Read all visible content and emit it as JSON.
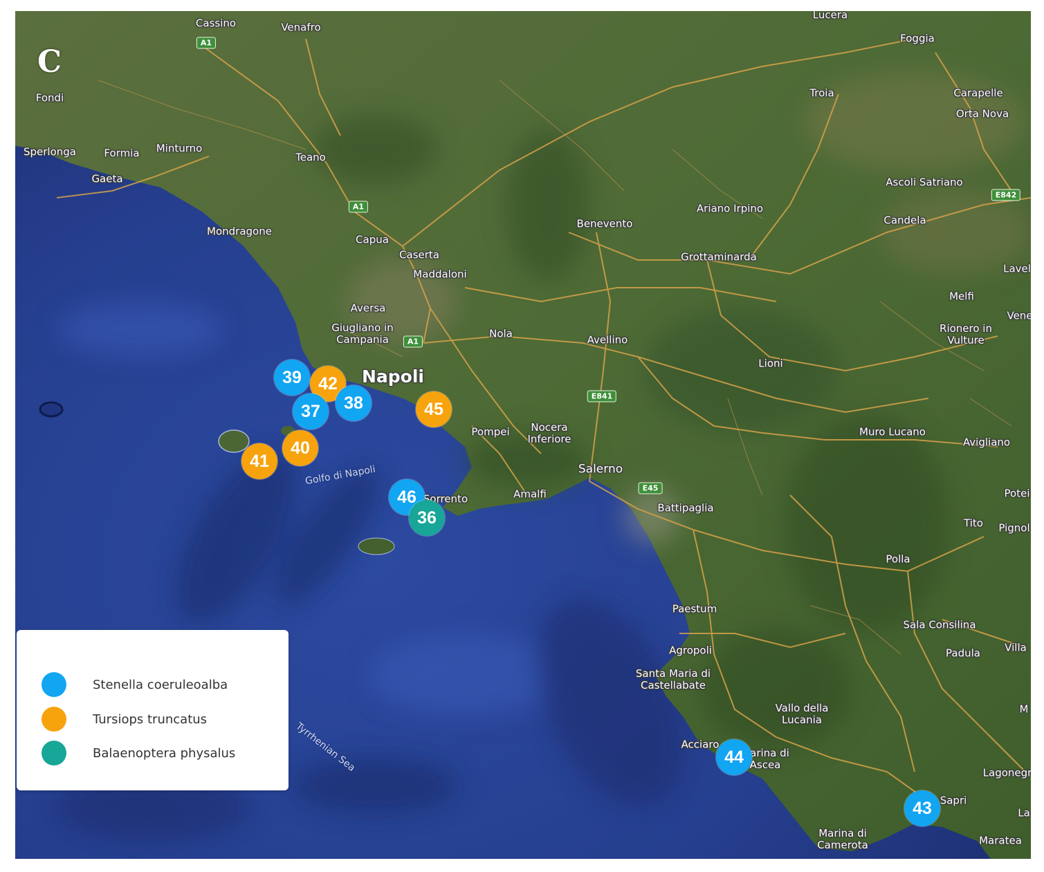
{
  "panel_label": "C",
  "colors": {
    "sea": "#2b3f92",
    "land": "#4f6a36",
    "road": "#d6a24a",
    "stenella": "#11a5f2",
    "tursiops": "#f7a30d",
    "balaenoptera": "#17a697"
  },
  "places": [
    {
      "name": "Cassino"
    },
    {
      "name": "Venafro"
    },
    {
      "name": "Lucera"
    },
    {
      "name": "Foggia"
    },
    {
      "name": "Fondi"
    },
    {
      "name": "Troia"
    },
    {
      "name": "Carapelle"
    },
    {
      "name": "Orta Nova"
    },
    {
      "name": "Sperlonga"
    },
    {
      "name": "Formia"
    },
    {
      "name": "Minturno"
    },
    {
      "name": "Teano"
    },
    {
      "name": "Gaeta"
    },
    {
      "name": "Ascoli Satriano"
    },
    {
      "name": "Ariano Irpino"
    },
    {
      "name": "Benevento"
    },
    {
      "name": "Candela"
    },
    {
      "name": "Mondragone"
    },
    {
      "name": "Capua"
    },
    {
      "name": "Caserta"
    },
    {
      "name": "Grottaminarda"
    },
    {
      "name": "Maddaloni"
    },
    {
      "name": "Lavel"
    },
    {
      "name": "Melfi"
    },
    {
      "name": "Aversa"
    },
    {
      "name": "Giugliano in Campania"
    },
    {
      "name": "Nola"
    },
    {
      "name": "Avellino"
    },
    {
      "name": "Rionero in Vulture"
    },
    {
      "name": "Vene"
    },
    {
      "name": "Lioni"
    },
    {
      "name": "Napoli"
    },
    {
      "name": "Pompei"
    },
    {
      "name": "Nocera Inferiore"
    },
    {
      "name": "Muro Lucano"
    },
    {
      "name": "Avigliano"
    },
    {
      "name": "Salerno"
    },
    {
      "name": "Golfo di Napoli"
    },
    {
      "name": "Sorrento"
    },
    {
      "name": "Amalfi"
    },
    {
      "name": "Potei"
    },
    {
      "name": "Battipaglia"
    },
    {
      "name": "Tito"
    },
    {
      "name": "Pignol"
    },
    {
      "name": "Polla"
    },
    {
      "name": "Paestum"
    },
    {
      "name": "Sala Consilina"
    },
    {
      "name": "Agropoli"
    },
    {
      "name": "Padula"
    },
    {
      "name": "Villa"
    },
    {
      "name": "Santa Maria di Castellabate"
    },
    {
      "name": "Vallo della Lucania"
    },
    {
      "name": "M"
    },
    {
      "name": "Tyrrhenian Sea"
    },
    {
      "name": "Acciaro"
    },
    {
      "name": "Marina di Ascea"
    },
    {
      "name": "Lagonegr"
    },
    {
      "name": "Sapri"
    },
    {
      "name": "La"
    },
    {
      "name": "Marina di Camerota"
    },
    {
      "name": "Maratea"
    }
  ],
  "road_shields": [
    "A1",
    "A1",
    "A1",
    "E842",
    "E841",
    "E45"
  ],
  "markers": [
    {
      "id": "39",
      "species": "stenella"
    },
    {
      "id": "42",
      "species": "tursiops"
    },
    {
      "id": "38",
      "species": "stenella"
    },
    {
      "id": "37",
      "species": "stenella"
    },
    {
      "id": "45",
      "species": "tursiops"
    },
    {
      "id": "40",
      "species": "tursiops"
    },
    {
      "id": "41",
      "species": "tursiops"
    },
    {
      "id": "46",
      "species": "stenella"
    },
    {
      "id": "36",
      "species": "balaenoptera"
    },
    {
      "id": "44",
      "species": "stenella"
    },
    {
      "id": "43",
      "species": "stenella"
    }
  ],
  "legend": [
    {
      "label": "Stenella coeruleoalba",
      "species": "stenella"
    },
    {
      "label": "Tursiops truncatus",
      "species": "tursiops"
    },
    {
      "label": "Balaenoptera physalus",
      "species": "balaenoptera"
    }
  ]
}
